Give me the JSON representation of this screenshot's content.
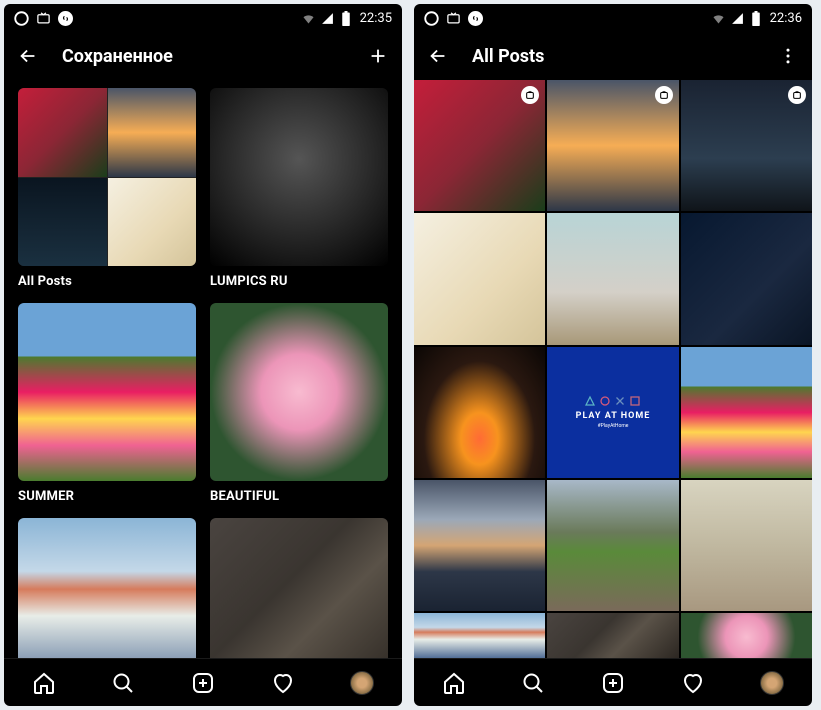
{
  "left": {
    "status": {
      "time": "22:35"
    },
    "header": {
      "title": "Сохраненное"
    },
    "collections": [
      {
        "label": "All Posts"
      },
      {
        "label": "LUMPICS RU"
      },
      {
        "label": "SUMMER"
      },
      {
        "label": "BEAUTIFUL"
      }
    ]
  },
  "right": {
    "status": {
      "time": "22:36"
    },
    "header": {
      "title": "All Posts"
    },
    "playstation": {
      "title": "PLAY AT HOME",
      "tag": "#PlayAtHome"
    }
  }
}
